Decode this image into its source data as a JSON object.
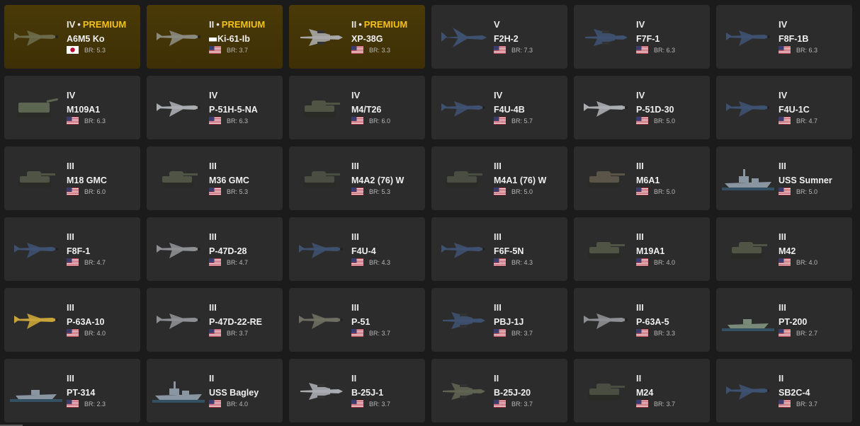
{
  "br_prefix": "BR: ",
  "premium_label": "PREMIUM",
  "vehicles": [
    {
      "rank": "IV",
      "premium": true,
      "name": "A6M5 Ko",
      "flag": "japan",
      "br": "5.3",
      "type": "plane",
      "color": "#6b6a4a"
    },
    {
      "rank": "II",
      "premium": true,
      "name": "Ki-61-Ib",
      "flag": "usa",
      "br": "3.7",
      "type": "plane",
      "color": "#8b8a80",
      "name_prefix_flag": true
    },
    {
      "rank": "II",
      "premium": true,
      "name": "XP-38G",
      "flag": "usa",
      "br": "3.3",
      "type": "twin",
      "color": "#a8a8a8"
    },
    {
      "rank": "V",
      "premium": false,
      "name": "F2H-2",
      "flag": "usa",
      "br": "7.3",
      "type": "jet",
      "color": "#3e5170"
    },
    {
      "rank": "IV",
      "premium": false,
      "name": "F7F-1",
      "flag": "usa",
      "br": "6.3",
      "type": "twin",
      "color": "#3e5170"
    },
    {
      "rank": "IV",
      "premium": false,
      "name": "F8F-1B",
      "flag": "usa",
      "br": "6.3",
      "type": "plane",
      "color": "#3e5170"
    },
    {
      "rank": "IV",
      "premium": false,
      "name": "M109A1",
      "flag": "usa",
      "br": "6.3",
      "type": "spg",
      "color": "#5d6650"
    },
    {
      "rank": "IV",
      "premium": false,
      "name": "P-51H-5-NA",
      "flag": "usa",
      "br": "6.3",
      "type": "plane",
      "color": "#a9acb0"
    },
    {
      "rank": "IV",
      "premium": false,
      "name": "M4/T26",
      "flag": "usa",
      "br": "6.0",
      "type": "tank",
      "color": "#4f5445"
    },
    {
      "rank": "IV",
      "premium": false,
      "name": "F4U-4B",
      "flag": "usa",
      "br": "5.7",
      "type": "plane",
      "color": "#3e5170"
    },
    {
      "rank": "IV",
      "premium": false,
      "name": "P-51D-30",
      "flag": "usa",
      "br": "5.0",
      "type": "plane",
      "color": "#a9acb0"
    },
    {
      "rank": "IV",
      "premium": false,
      "name": "F4U-1C",
      "flag": "usa",
      "br": "4.7",
      "type": "plane",
      "color": "#3e5170"
    },
    {
      "rank": "III",
      "premium": false,
      "name": "M18 GMC",
      "flag": "usa",
      "br": "6.0",
      "type": "tank",
      "color": "#4f5445"
    },
    {
      "rank": "III",
      "premium": false,
      "name": "M36 GMC",
      "flag": "usa",
      "br": "5.3",
      "type": "tank",
      "color": "#4f5445"
    },
    {
      "rank": "III",
      "premium": false,
      "name": "M4A2 (76) W",
      "flag": "usa",
      "br": "5.3",
      "type": "tank",
      "color": "#4a4e42"
    },
    {
      "rank": "III",
      "premium": false,
      "name": "M4A1 (76) W",
      "flag": "usa",
      "br": "5.0",
      "type": "tank",
      "color": "#4a4e42"
    },
    {
      "rank": "III",
      "premium": false,
      "name": "M6A1",
      "flag": "usa",
      "br": "5.0",
      "type": "tank",
      "color": "#5b5448"
    },
    {
      "rank": "III",
      "premium": false,
      "name": "USS Sumner",
      "flag": "usa",
      "br": "5.0",
      "type": "ship",
      "color": "#8a95a2"
    },
    {
      "rank": "III",
      "premium": false,
      "name": "F8F-1",
      "flag": "usa",
      "br": "4.7",
      "type": "plane",
      "color": "#3e5170"
    },
    {
      "rank": "III",
      "premium": false,
      "name": "P-47D-28",
      "flag": "usa",
      "br": "4.7",
      "type": "plane",
      "color": "#8d8f93"
    },
    {
      "rank": "III",
      "premium": false,
      "name": "F4U-4",
      "flag": "usa",
      "br": "4.3",
      "type": "plane",
      "color": "#3e5170"
    },
    {
      "rank": "III",
      "premium": false,
      "name": "F6F-5N",
      "flag": "usa",
      "br": "4.3",
      "type": "plane",
      "color": "#3e5170"
    },
    {
      "rank": "III",
      "premium": false,
      "name": "M19A1",
      "flag": "usa",
      "br": "4.0",
      "type": "tank",
      "color": "#4f5445"
    },
    {
      "rank": "III",
      "premium": false,
      "name": "M42",
      "flag": "usa",
      "br": "4.0",
      "type": "tank",
      "color": "#4f5445"
    },
    {
      "rank": "III",
      "premium": false,
      "name": "P-63A-10",
      "flag": "usa",
      "br": "4.0",
      "type": "plane",
      "color": "#c9a43a"
    },
    {
      "rank": "III",
      "premium": false,
      "name": "P-47D-22-RE",
      "flag": "usa",
      "br": "3.7",
      "type": "plane",
      "color": "#8d8f93"
    },
    {
      "rank": "III",
      "premium": false,
      "name": "P-51",
      "flag": "usa",
      "br": "3.7",
      "type": "plane",
      "color": "#6e6e62"
    },
    {
      "rank": "III",
      "premium": false,
      "name": "PBJ-1J",
      "flag": "usa",
      "br": "3.7",
      "type": "twin",
      "color": "#3e5170"
    },
    {
      "rank": "III",
      "premium": false,
      "name": "P-63A-5",
      "flag": "usa",
      "br": "3.3",
      "type": "plane",
      "color": "#8d8f93"
    },
    {
      "rank": "III",
      "premium": false,
      "name": "PT-200",
      "flag": "usa",
      "br": "2.7",
      "type": "boat",
      "color": "#7a8a78"
    },
    {
      "rank": "III",
      "premium": false,
      "name": "PT-314",
      "flag": "usa",
      "br": "2.3",
      "type": "boat",
      "color": "#8a95a2"
    },
    {
      "rank": "II",
      "premium": false,
      "name": "USS Bagley",
      "flag": "usa",
      "br": "4.0",
      "type": "ship",
      "color": "#8a95a2"
    },
    {
      "rank": "II",
      "premium": false,
      "name": "B-25J-1",
      "flag": "usa",
      "br": "3.7",
      "type": "twin",
      "color": "#a9acb0"
    },
    {
      "rank": "II",
      "premium": false,
      "name": "B-25J-20",
      "flag": "usa",
      "br": "3.7",
      "type": "twin",
      "color": "#5f6352"
    },
    {
      "rank": "II",
      "premium": false,
      "name": "M24",
      "flag": "usa",
      "br": "3.7",
      "type": "tank",
      "color": "#4a4e42"
    },
    {
      "rank": "II",
      "premium": false,
      "name": "SB2C-4",
      "flag": "usa",
      "br": "3.7",
      "type": "plane",
      "color": "#3e5170"
    }
  ]
}
